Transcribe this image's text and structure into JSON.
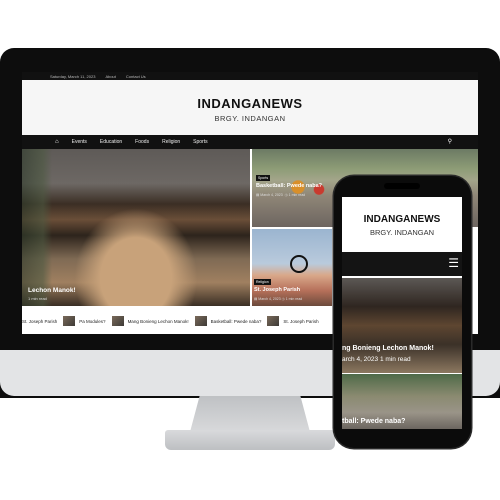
{
  "topbar": {
    "date": "Saturday, March 11, 2023",
    "links": [
      "About",
      "Contact Us"
    ]
  },
  "site": {
    "title": "INDANGANEWS",
    "tagline": "BRGY. INDANGAN"
  },
  "nav": {
    "items": [
      "Events",
      "Education",
      "Foods",
      "Religion",
      "Sports"
    ]
  },
  "hero": {
    "title": "Lechon Manok!",
    "meta": "1 min read"
  },
  "card_sports": {
    "badge": "Sports",
    "title": "Basketball: Pwede naba?",
    "date": "March 4, 2023",
    "read": "1 min read"
  },
  "card_religion": {
    "badge": "Religion",
    "title": "St. Joseph Parish",
    "date": "March 4, 2023",
    "read": "1 min read"
  },
  "ticker": {
    "items": [
      "St. Joseph Parish",
      "Pa Modules?",
      "Mang Bonieng Lechon Manok!",
      "Basketball: Pwede naba?",
      "St. Joseph Parish"
    ]
  },
  "phone": {
    "title": "INDANGANEWS",
    "tagline": "BRGY. INDANGAN",
    "hero_title": "ng Bonieng Lechon Manok!",
    "hero_meta": "arch 4, 2023   1 min read",
    "card_title": "tball: Pwede naba?"
  }
}
